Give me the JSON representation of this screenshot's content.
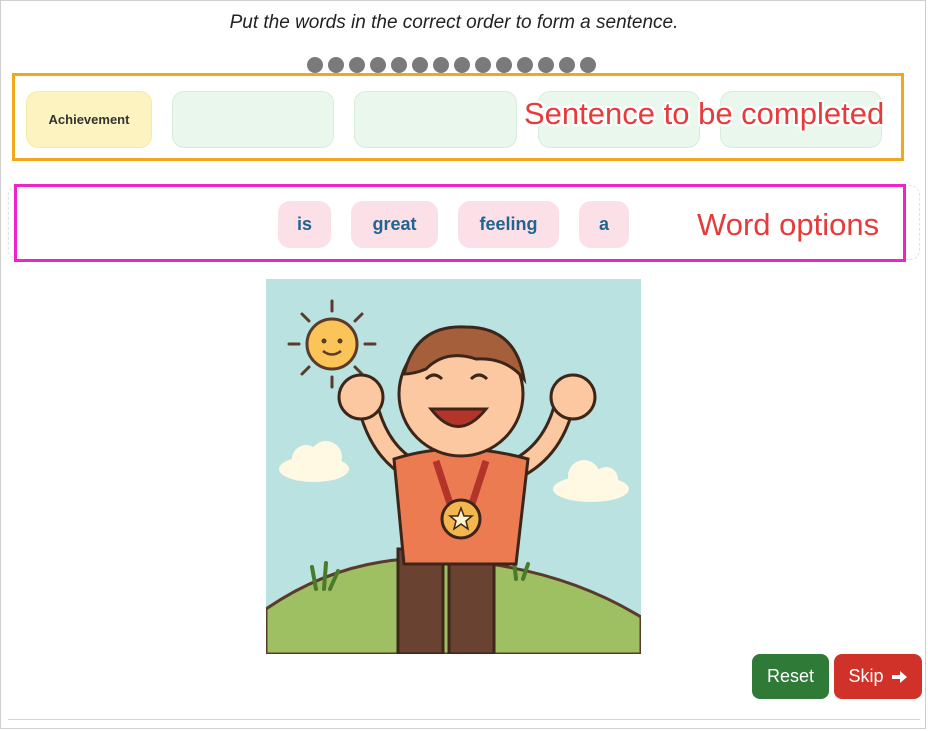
{
  "instruction": "Put the words in the correct order to form a sentence.",
  "progress": {
    "total_dots": 14
  },
  "sentence": {
    "slots": [
      {
        "word": "Achievement",
        "filled": true
      },
      {
        "word": "",
        "filled": false
      },
      {
        "word": "",
        "filled": false
      },
      {
        "word": "",
        "filled": false
      },
      {
        "word": "",
        "filled": false
      }
    ]
  },
  "options": {
    "words": [
      "is",
      "great",
      "feeling",
      "a"
    ]
  },
  "annotations": {
    "sentence_label": "Sentence to be completed",
    "options_label": "Word options"
  },
  "buttons": {
    "reset_label": "Reset",
    "skip_label": "Skip"
  },
  "colors": {
    "sentence_highlight": "#f1a81c",
    "options_highlight": "#ec24c9",
    "annotation_text": "#e53b3b",
    "reset": "#2f7a36",
    "skip": "#d03128"
  },
  "icons": {
    "skip": "arrow-right-icon",
    "illustration": "happy-child-with-medal"
  }
}
